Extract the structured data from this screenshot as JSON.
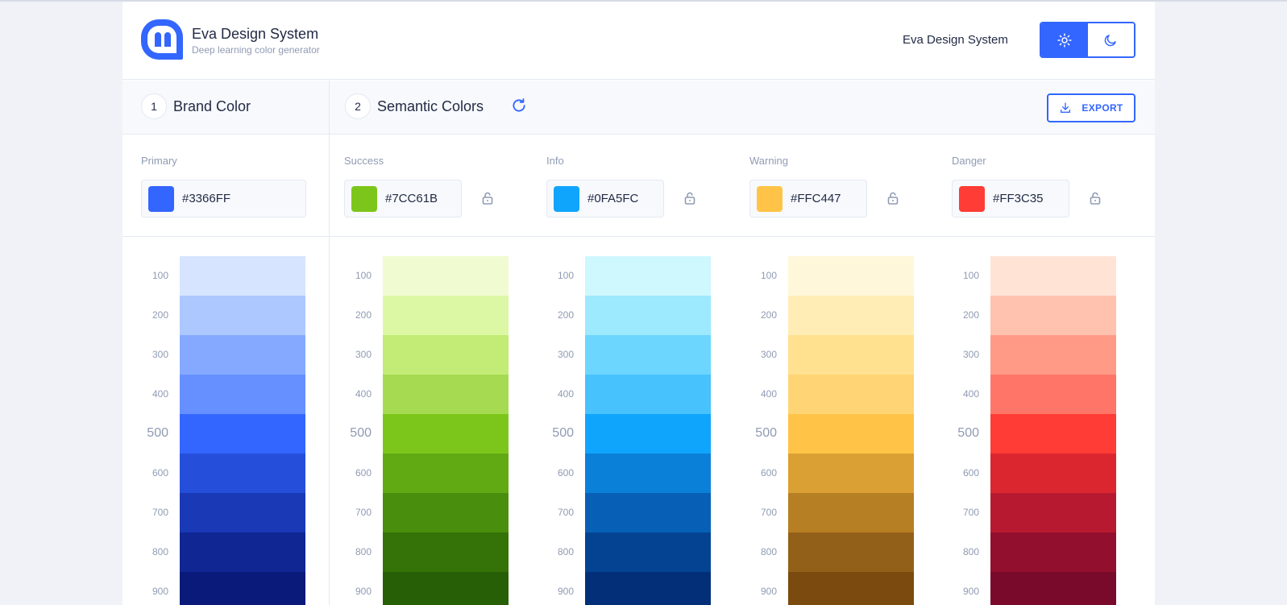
{
  "header": {
    "title": "Eva Design System",
    "subtitle": "Deep learning color generator",
    "nav_link": "Eva Design System",
    "theme_light_icon": "sun-icon",
    "theme_dark_icon": "moon-icon"
  },
  "sections": {
    "brand": {
      "step": "1",
      "title": "Brand Color"
    },
    "semantic": {
      "step": "2",
      "title": "Semantic Colors",
      "refresh_icon": "refresh-icon"
    },
    "export_label": "EXPORT",
    "export_icon": "download-icon"
  },
  "colors": [
    {
      "label": "Primary",
      "hex": "#3366FF",
      "lockable": false,
      "shades": [
        "#D6E4FF",
        "#ADC8FF",
        "#84A9FF",
        "#6690FF",
        "#3366FF",
        "#254EDB",
        "#1939B7",
        "#102693",
        "#091A7A"
      ]
    },
    {
      "label": "Success",
      "hex": "#7CC61B",
      "lockable": true,
      "shades": [
        "#F0FBD1",
        "#DDF8A5",
        "#C2EC75",
        "#A6DA50",
        "#7CC61B",
        "#61AA13",
        "#498E0D",
        "#357208",
        "#265F05"
      ]
    },
    {
      "label": "Info",
      "hex": "#0FA5FC",
      "lockable": true,
      "shades": [
        "#CEF7FE",
        "#9DE9FE",
        "#6CD6FE",
        "#47C2FD",
        "#0FA5FC",
        "#0A80D8",
        "#0760B5",
        "#044392",
        "#022F78"
      ]
    },
    {
      "label": "Warning",
      "hex": "#FFC447",
      "lockable": true,
      "shades": [
        "#FFF7DA",
        "#FFEDB5",
        "#FFE190",
        "#FFD475",
        "#FFC447",
        "#DBA033",
        "#B77F23",
        "#93601A",
        "#7A4A0E"
      ]
    },
    {
      "label": "Danger",
      "hex": "#FF3C35",
      "lockable": true,
      "shades": [
        "#FFE4D6",
        "#FFC2AE",
        "#FF9A86",
        "#FF7568",
        "#FF3C35",
        "#DB2630",
        "#B71A30",
        "#930F2E",
        "#7A0A2C"
      ]
    }
  ],
  "shade_levels": [
    "100",
    "200",
    "300",
    "400",
    "500",
    "600",
    "700",
    "800",
    "900"
  ]
}
